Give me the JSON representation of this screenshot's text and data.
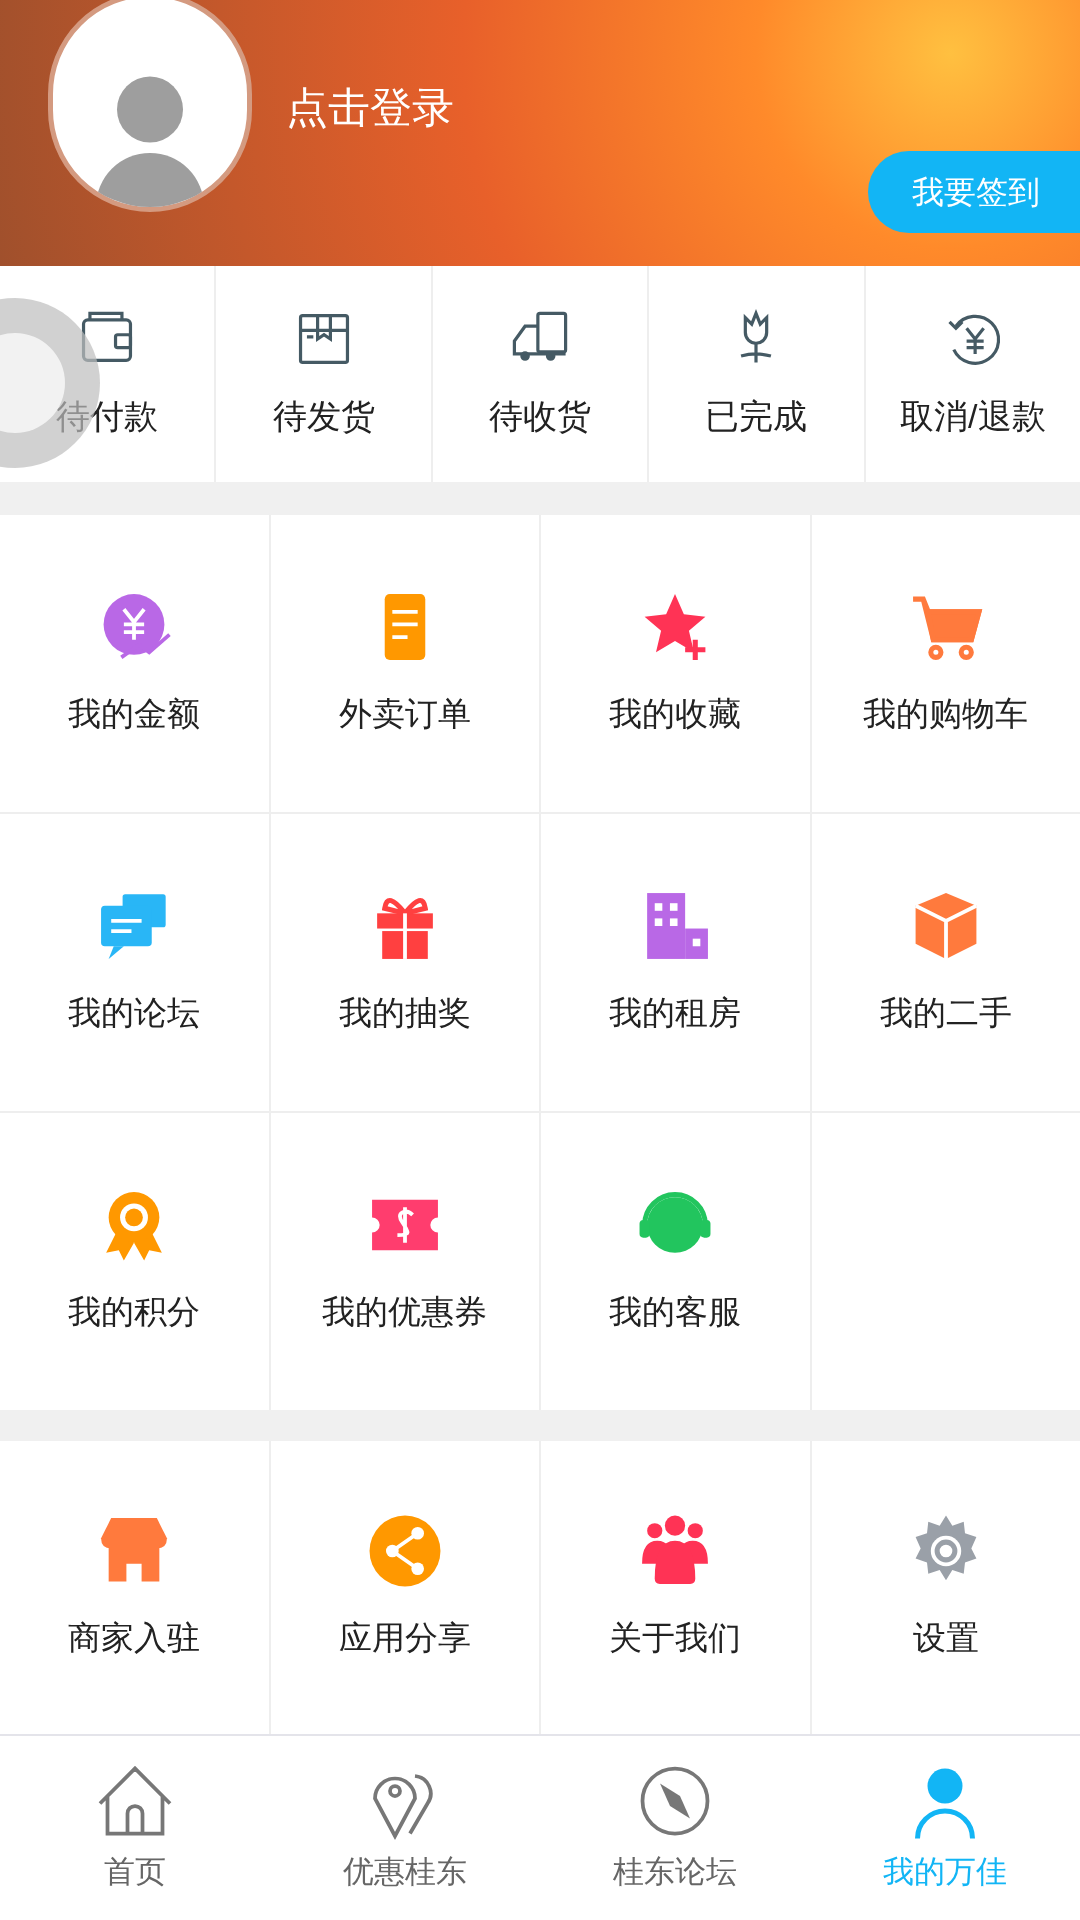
{
  "header": {
    "login_text": "点击登录",
    "checkin_button": "我要签到"
  },
  "orders": [
    {
      "label": "待付款"
    },
    {
      "label": "待发货"
    },
    {
      "label": "待收货"
    },
    {
      "label": "已完成"
    },
    {
      "label": "取消/退款"
    }
  ],
  "menu_sections": [
    [
      {
        "label": "我的金额"
      },
      {
        "label": "外卖订单"
      },
      {
        "label": "我的收藏"
      },
      {
        "label": "我的购物车"
      },
      {
        "label": "我的论坛"
      },
      {
        "label": "我的抽奖"
      },
      {
        "label": "我的租房"
      },
      {
        "label": "我的二手"
      },
      {
        "label": "我的积分"
      },
      {
        "label": "我的优惠券"
      },
      {
        "label": "我的客服"
      }
    ],
    [
      {
        "label": "商家入驻"
      },
      {
        "label": "应用分享"
      },
      {
        "label": "关于我们"
      },
      {
        "label": "设置"
      }
    ]
  ],
  "tabs": [
    {
      "label": "首页",
      "selected": false
    },
    {
      "label": "优惠桂东",
      "selected": false
    },
    {
      "label": "桂东论坛",
      "selected": false
    },
    {
      "label": "我的万佳",
      "selected": true
    }
  ]
}
